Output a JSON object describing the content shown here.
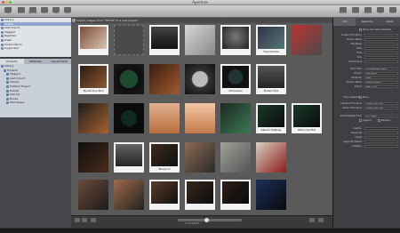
{
  "window": {
    "title": "Aperture"
  },
  "toolbar": {
    "items": [
      "Import",
      "Browser",
      "Split View",
      "Viewer",
      "Loupe",
      "Stack",
      "Compare",
      "Adjust",
      "Share"
    ],
    "right_items": [
      "Inspector",
      "Library",
      "Keywords",
      "Print",
      "Email"
    ]
  },
  "sidebar": {
    "top_rows": [
      "Library",
      "Photos",
      "Last Import",
      "Flagged",
      "Rejected",
      "Trash",
      "Smart Album",
      "Loupe Test"
    ],
    "tabs": [
      "Projects",
      "Metadata",
      "Adjustments"
    ],
    "project_rows": [
      "Library",
      "Projects",
      "Flagged",
      "Last Import",
      "Shared",
      "Untitled Project",
      "Events",
      "Albums",
      "Books",
      "Web Pages"
    ]
  },
  "main": {
    "header_text": "Import images from \"TOKYO\" to a new project",
    "captions": [
      "Flea Market",
      "Mysterious Bus",
      "Halloween",
      "Bullet Hole",
      "Kabuki Hallway",
      "Welcome Mat",
      "Boxed In"
    ],
    "pages_text": "1 2 3 4 5 6 7"
  },
  "inspector": {
    "tabs": [
      "Info",
      "Keywords",
      "Adjust"
    ],
    "section1_checkbox": "Show only when Selected",
    "fields1": [
      {
        "label": "Image Information",
        "value": ""
      },
      {
        "label": "Version Name",
        "value": ""
      },
      {
        "label": "File Name",
        "value": ""
      },
      {
        "label": "Date",
        "value": ""
      },
      {
        "label": "Time",
        "value": ""
      },
      {
        "label": "Size",
        "value": ""
      },
      {
        "label": "Dimensions",
        "value": ""
      }
    ],
    "fields2": [
      {
        "label": "Store Files",
        "value": "In the Aperture Library"
      },
      {
        "label": "Project",
        "value": "New Project"
      },
      {
        "label": "Subfolder",
        "value": "None"
      },
      {
        "label": "Version Name",
        "value": "Master Filename"
      },
      {
        "label": "Import",
        "value": "RAW + JPEG"
      }
    ],
    "time_adjustment": {
      "label": "Time Adjustment",
      "checkbox": "None"
    },
    "fields3": [
      {
        "label": "Camera Time Zone",
        "value": "Current Time Zone"
      },
      {
        "label": "Actual Time Zone",
        "value": "Current Time Zone"
      }
    ],
    "preset_label": "Add Metadata From",
    "preset_value": "IPTC - Basic",
    "append_label": "Append",
    "replace_label": "Replace",
    "fields4": [
      {
        "label": "Caption",
        "value": ""
      },
      {
        "label": "Keywords",
        "value": ""
      },
      {
        "label": "Credit",
        "value": ""
      },
      {
        "label": "Copyright Notice",
        "value": ""
      },
      {
        "label": "Category",
        "value": ""
      }
    ]
  },
  "colors": {
    "accent": "#8fa8cf",
    "grid_bg": "#5a5a5a",
    "inspector_bg": "#3e3f43"
  }
}
